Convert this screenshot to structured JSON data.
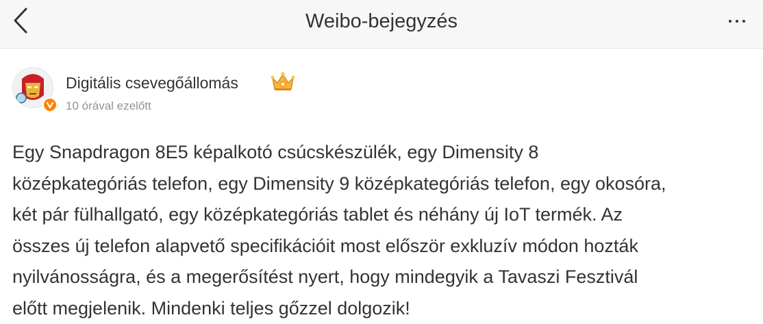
{
  "header": {
    "title": "Weibo-bejegyzés",
    "back_icon": "chevron-left-icon",
    "more_icon": "more-horizontal-icon"
  },
  "author": {
    "name": "Digitális csevegőállomás",
    "time": "10 órával ezelőtt",
    "badge_icon": "crown-icon",
    "verified_icon": "verified-v-icon",
    "verified_color": "#ff8200"
  },
  "post": {
    "text": "Egy Snapdragon 8E5 képalkotó csúcskészülék, egy Dimensity 8\nközépkategóriás telefon, egy Dimensity 9 középkategóriás telefon, egy okosóra,\nkét pár fülhallgató, egy középkategóriás tablet és néhány új IoT termék. Az\nösszes új telefon alapvető specifikációit most először exkluzív módon hozták\nnyilvánosságra, és a megerősítést nyert, hogy mindegyik a Tavaszi Fesztivál\nelőtt megjelenik. Mindenki teljes gőzzel dolgozik!"
  }
}
